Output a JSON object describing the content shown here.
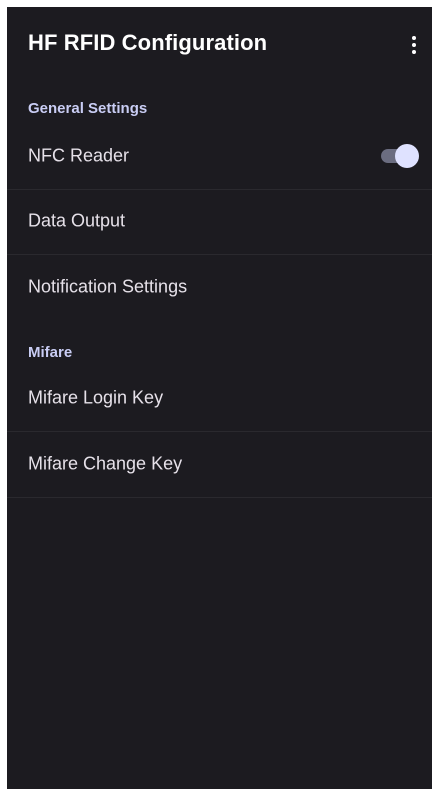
{
  "appbar": {
    "title": "HF RFID Configuration",
    "overflow_icon": "more-vert-icon"
  },
  "sections": {
    "general": {
      "title": "General Settings",
      "nfc_reader": {
        "label": "NFC Reader",
        "enabled": true
      },
      "data_output": {
        "label": "Data Output"
      },
      "notification_settings": {
        "label": "Notification Settings"
      }
    },
    "mifare": {
      "title": "Mifare",
      "login_key": {
        "label": "Mifare Login Key"
      },
      "change_key": {
        "label": "Mifare Change Key"
      }
    }
  },
  "colors": {
    "background": "#1c1b20",
    "category_text": "#c9cdf4",
    "switch_thumb": "#dfe2ff",
    "switch_track": "#6b6d80"
  }
}
